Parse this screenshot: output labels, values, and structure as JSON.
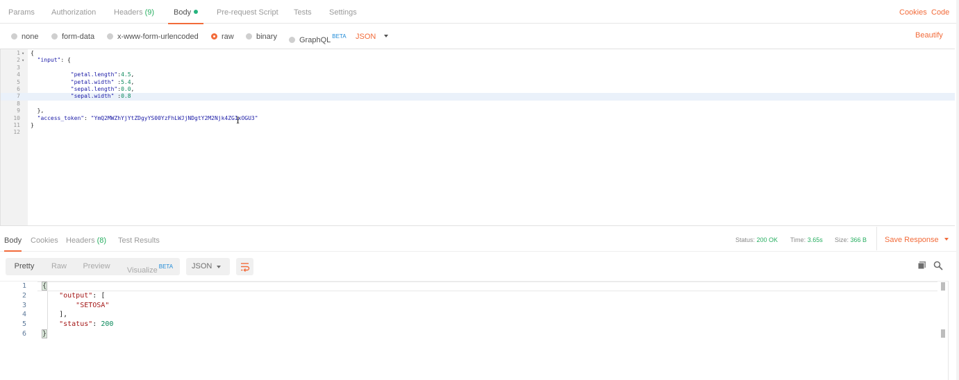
{
  "request_tabs": [
    {
      "label": "Params"
    },
    {
      "label": "Authorization"
    },
    {
      "label": "Headers",
      "count": "(9)"
    },
    {
      "label": "Body",
      "active": true
    },
    {
      "label": "Pre-request Script"
    },
    {
      "label": "Tests"
    },
    {
      "label": "Settings"
    }
  ],
  "right_links": {
    "cookies": "Cookies",
    "code": "Code"
  },
  "body_modes": {
    "none": "none",
    "form_data": "form-data",
    "urlencoded": "x-www-form-urlencoded",
    "raw": "raw",
    "binary": "binary",
    "graphql": "GraphQL",
    "beta": "BETA",
    "selected": "raw"
  },
  "language": "JSON",
  "beautify": "Beautify",
  "request_body_lines": [
    {
      "n": "1",
      "fold": true,
      "code": "{"
    },
    {
      "n": "2",
      "fold": true,
      "code": "  \"input\": {"
    },
    {
      "n": "3",
      "code": ""
    },
    {
      "n": "4",
      "code": "            \"petal.length\":4.5,"
    },
    {
      "n": "5",
      "code": "            \"petal.width\" :5.4,"
    },
    {
      "n": "6",
      "code": "            \"sepal.length\":0.0,"
    },
    {
      "n": "7",
      "code": "            \"sepal.width\" :0.8",
      "active": true
    },
    {
      "n": "8",
      "code": ""
    },
    {
      "n": "9",
      "code": "  },"
    },
    {
      "n": "10",
      "code": "  \"access_token\": \"YmQ2MWZhYjYtZDgyYS00YzFhLWJjNDgtY2M2Njk4ZGIxOGU3\""
    },
    {
      "n": "11",
      "code": "}"
    },
    {
      "n": "12",
      "code": ""
    }
  ],
  "response_tabs": [
    {
      "label": "Body",
      "active": true
    },
    {
      "label": "Cookies"
    },
    {
      "label": "Headers",
      "count": "(8)"
    },
    {
      "label": "Test Results"
    }
  ],
  "response_meta": {
    "status_label": "Status:",
    "status": "200 OK",
    "time_label": "Time:",
    "time": "3.65s",
    "size_label": "Size:",
    "size": "366 B",
    "save": "Save Response"
  },
  "view_tabs": [
    {
      "label": "Pretty",
      "active": true
    },
    {
      "label": "Raw"
    },
    {
      "label": "Preview"
    },
    {
      "label": "Visualize",
      "beta": "BETA"
    }
  ],
  "response_format": "JSON",
  "response_lines": [
    {
      "n": "1",
      "code": "{"
    },
    {
      "n": "2",
      "code": "    \"output\": ["
    },
    {
      "n": "3",
      "code": "        \"SETOSA\""
    },
    {
      "n": "4",
      "code": "    ],"
    },
    {
      "n": "5",
      "code": "    \"status\": 200"
    },
    {
      "n": "6",
      "code": "}"
    }
  ],
  "colors": {
    "accent": "#f26b3a",
    "green": "#27ae60",
    "beta_blue": "#1f8ad7"
  },
  "icons": [
    "wrap-lines-icon",
    "copy-icon",
    "search-icon",
    "chevron-down-icon"
  ]
}
